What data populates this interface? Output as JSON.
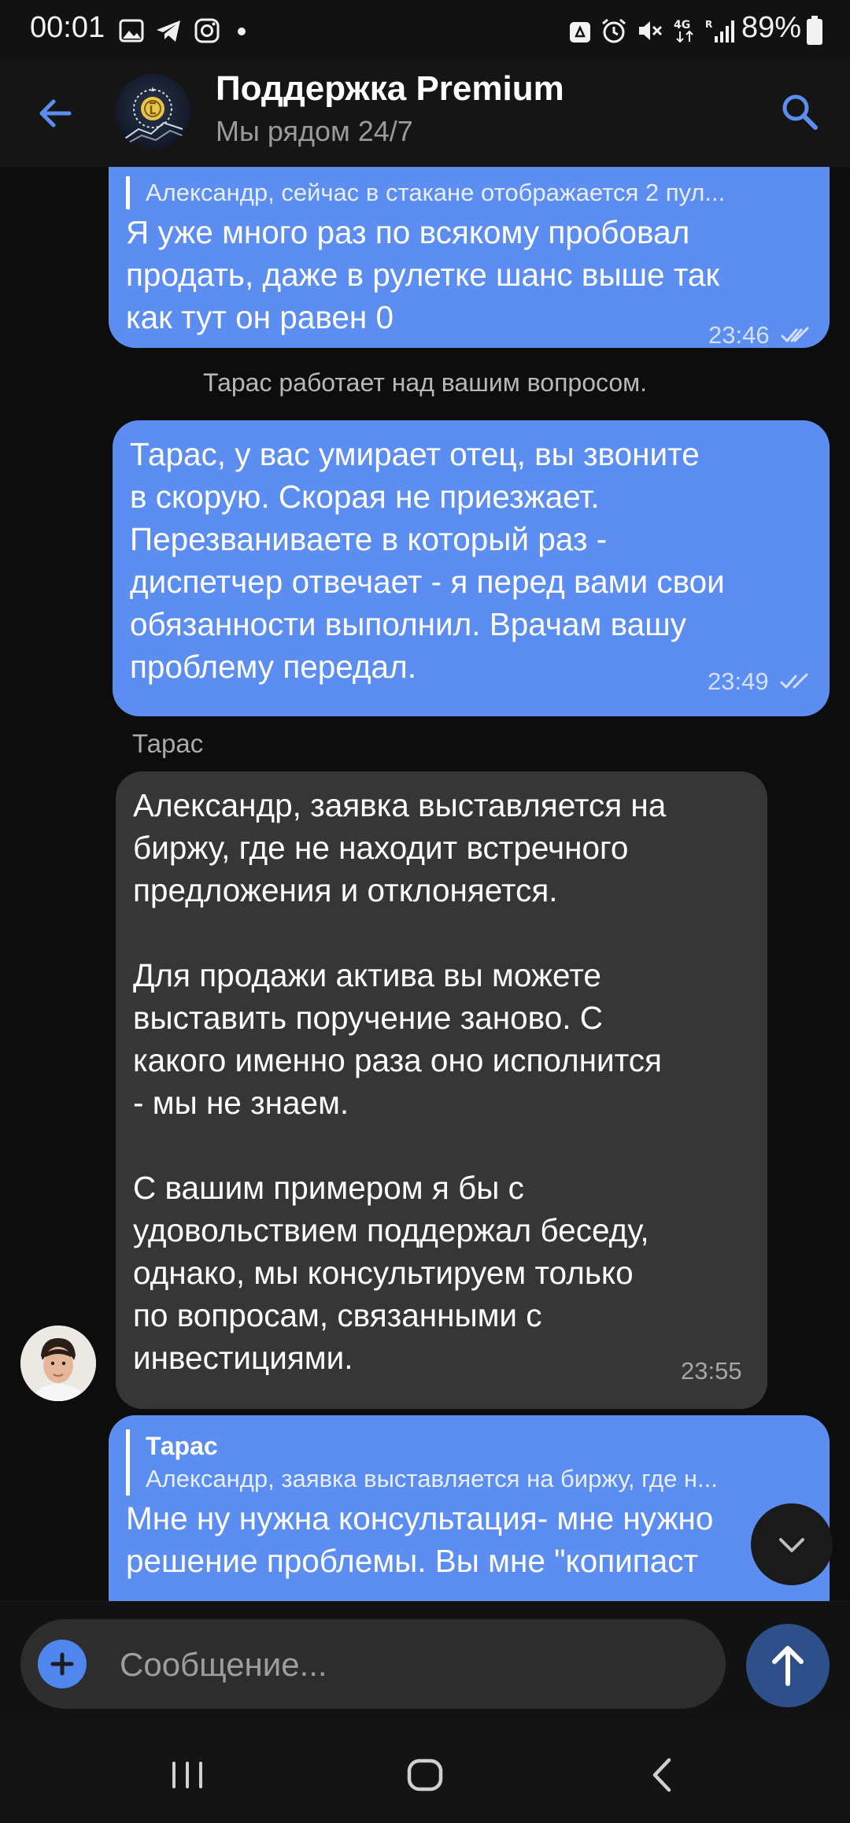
{
  "status_bar": {
    "time": "00:01",
    "battery_percent": "89%",
    "network": "4G",
    "icons": [
      "gallery-icon",
      "telegram-icon",
      "instagram-icon",
      "dot-icon",
      "recycle-icon",
      "alarm-icon",
      "mute-icon",
      "network-4g-icon",
      "signal-icon",
      "battery-icon"
    ]
  },
  "header": {
    "title": "Поддержка Premium",
    "subtitle": "Мы рядом 24/7",
    "icons": [
      "back-arrow-icon",
      "channel-avatar",
      "search-icon"
    ]
  },
  "messages": [
    {
      "direction": "outgoing",
      "reply_text": "Александр, сейчас в стакане отображается 2 пул...",
      "text": "Я уже много раз по всякому пробовал\nпродать, даже в рулетке шанс выше так\nкак тут он равен 0",
      "time": "23:46",
      "status": "read"
    },
    {
      "type": "service",
      "text": "Тарас работает над вашим вопросом."
    },
    {
      "direction": "outgoing",
      "text": "Тарас, у вас умирает отец, вы звоните\nв скорую. Скорая не приезжает.\nПерезваниваете в который раз -\nдиспетчер отвечает - я перед вами свои\nобязанности выполнил. Врачам вашу\nпроблему передал.",
      "time": "23:49",
      "status": "read"
    },
    {
      "direction": "incoming",
      "sender": "Тарас",
      "text": "Александр, заявка выставляется на\nбиржу, где не находит встречного\nпредложения и отклоняется.\n\nДля продажи актива вы можете\nвыставить поручение заново. С\nкакого именно раза оно исполнится\n- мы не знаем.\n\nС вашим примером я бы с\nудовольствием поддержал беседу,\nоднако, мы консультируем только\nпо вопросам, связанными с\nинвестициями.",
      "time": "23:55"
    },
    {
      "direction": "outgoing",
      "reply_name": "Тарас",
      "reply_text": "Александр, заявка выставляется на биржу, где н...",
      "text": "Мне ну нужна консультация- мне нужно\nрешение проблемы. Вы мне \"копипаст"
    }
  ],
  "input": {
    "placeholder": "Сообщение..."
  },
  "colors": {
    "outgoing_bubble": "#5b8ef0",
    "incoming_bubble": "#363636",
    "accent": "#4f86ee",
    "background": "#0d0d0d"
  },
  "nav_icons": [
    "recent-apps-icon",
    "home-icon",
    "nav-back-icon"
  ]
}
